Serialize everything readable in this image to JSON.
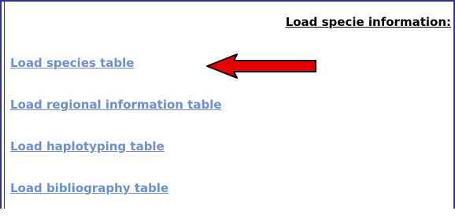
{
  "section": {
    "heading": "Load specie information:"
  },
  "links": [
    {
      "label": "Load species table"
    },
    {
      "label": "Load regional information table"
    },
    {
      "label": "Load haplotyping table"
    },
    {
      "label": "Load bibliography table"
    }
  ],
  "colors": {
    "link": "#6b8ed6",
    "frame": "#2e3192",
    "arrow_fill": "#e60000"
  },
  "icons": {
    "arrow": "left-arrow-icon"
  }
}
